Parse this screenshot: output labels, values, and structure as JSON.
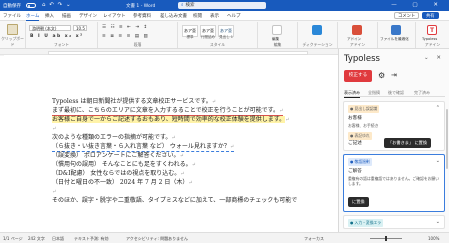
{
  "titlebar": {
    "autosave": "自動保存",
    "quick_access": "⌂ ↶ ↷ ⌄",
    "doc_title": "文書 1 - Word",
    "doc_saved": "ワ ファイル",
    "search_placeholder": "検索",
    "user_area": "",
    "window_controls": "— ▢ ✕",
    "accent": "#185abd"
  },
  "menu": {
    "tabs": [
      "ファイル",
      "ホーム",
      "挿入",
      "描画",
      "デザイン",
      "レイアウト",
      "参考資料",
      "差し込み文書",
      "校閲",
      "表示",
      "ヘルプ"
    ],
    "active_index": 1,
    "right_buttons": [
      "コメント",
      "共有"
    ]
  },
  "ribbon": {
    "groups": [
      "クリップボード",
      "フォント",
      "段落",
      "スタイル",
      "編集",
      "ディクテーション",
      "アドイン",
      "アドイン"
    ],
    "font_name": "游明朝 (本文)",
    "font_size": "10.5",
    "styles": [
      {
        "label": "あア亜",
        "sub": "標準"
      },
      {
        "label": "あア亜",
        "sub": "行間詰め"
      },
      {
        "label": "あア亜",
        "sub": "見出し 1"
      }
    ],
    "right_buttons": [
      "編集",
      "ディクテーション",
      "アドイン",
      "ファイルを最適化",
      "Typoless"
    ]
  },
  "document": {
    "lines": [
      "Typoless は朝日新聞社が提供する文章校正サービスです。",
      "まず最初に、こちらのエリアに文章を入力するることで校正を行うことが可能です。",
      "お客様ご自身で一からご記述するおもあり、短時間で効率的な校正体験を提供します。",
      "",
      "次のような種類のエラーの指摘が可能です。",
      "（ら抜き・い抜き言葉・ら入れ言葉 など） ウォール見れますか？",
      "（誤変換） ポロアンケートにご解答ください。",
      "（慣用句の誤用） そんなことにも足をすくわれる。",
      "（D&I配慮） 女性ならではの視点を取り込む。",
      "（日付と曜日の不一致） 2024 年 7 月 2 日（木）",
      "",
      "そのほか、誤字・脱字や二重敬語、タイプミスなどに加えて、一部商標のチェックも可能で"
    ]
  },
  "status": {
    "page": "1/1 ページ",
    "words": "242 文字",
    "lang": "日本語",
    "input": "テキスト予測: 有効",
    "accessibility": "アクセシビリティ: 問題ありません",
    "focus": "フォーカス",
    "zoom": "100%"
  },
  "panel": {
    "title": "Typoless",
    "controls": "⌄ ✕",
    "proof_button": "校正する",
    "tabs": [
      "表示済み",
      "全指摘",
      "後で確認",
      "完了済み"
    ],
    "active_tab": 0,
    "cards": [
      {
        "category": "● 見出し誤認識",
        "original": "お客様",
        "desc": "お客様、お手続き"
      },
      {
        "category": "● 表記ゆれ",
        "original": "ご記述",
        "desc": "",
        "suggestion": "「お書きま」 に置換"
      },
      {
        "category": "● 敬語過剰",
        "original": "ご解答",
        "desc": "重複有の語は重複語ではありません。ご確認をお願いします。",
        "suggestion": "に置換"
      },
      {
        "category": "● 入力・変換エラ",
        "original": "",
        "desc": ""
      }
    ]
  }
}
